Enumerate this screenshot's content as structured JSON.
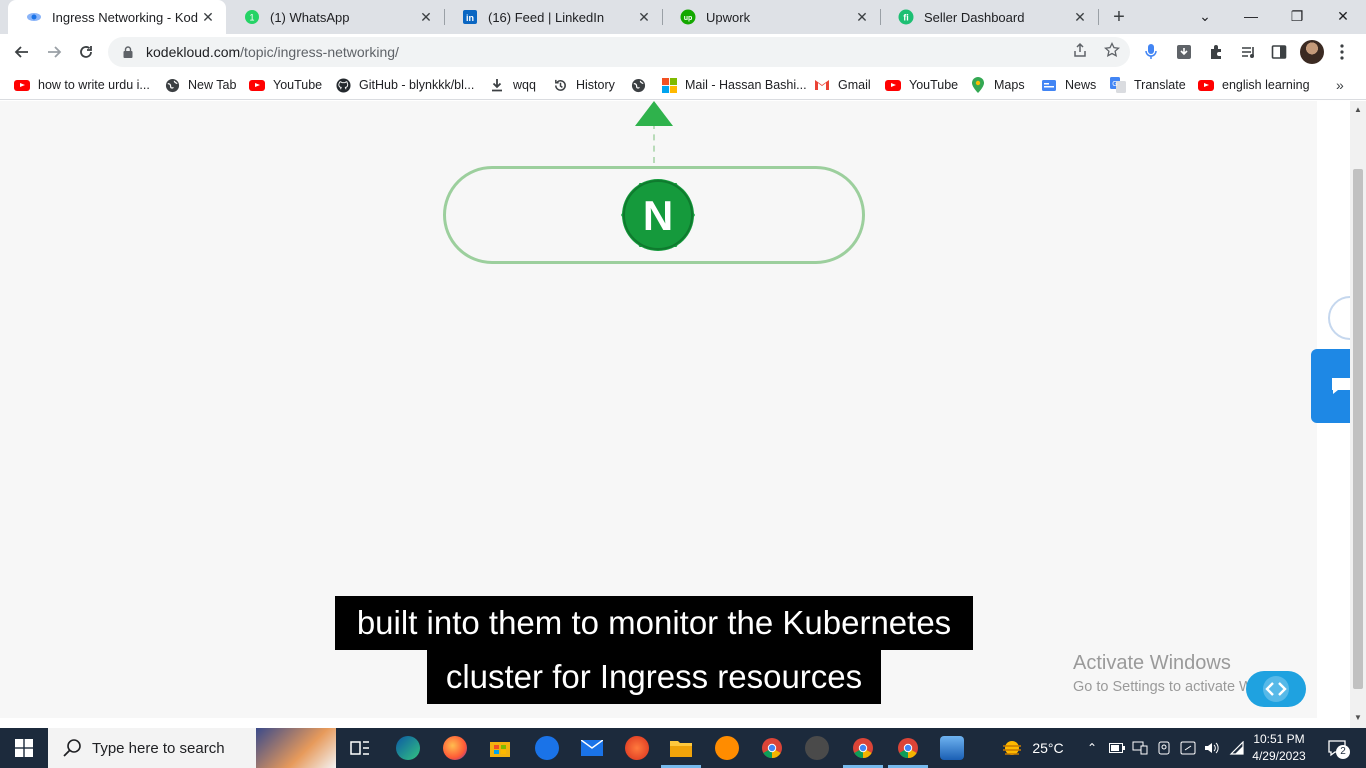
{
  "browser": {
    "tabs": [
      {
        "title": "Ingress Networking - KodeKl",
        "active": true,
        "favicon": "kodekloud-icon"
      },
      {
        "title": "(1) WhatsApp",
        "active": false,
        "favicon": "whatsapp-icon"
      },
      {
        "title": "(16) Feed | LinkedIn",
        "active": false,
        "favicon": "linkedin-icon"
      },
      {
        "title": "Upwork",
        "active": false,
        "favicon": "upwork-icon"
      },
      {
        "title": "Seller Dashboard",
        "active": false,
        "favicon": "fiverr-icon"
      }
    ],
    "new_tab_symbol": "+",
    "window_controls": {
      "dropdown": "⌄",
      "minimize": "—",
      "restore": "❐",
      "close": "✕"
    },
    "url_host": "kodekloud.com",
    "url_path": "/topic/ingress-networking/"
  },
  "bookmarks": [
    {
      "label": "how to write urdu i...",
      "icon": "youtube-icon"
    },
    {
      "label": "New Tab",
      "icon": "globe-icon"
    },
    {
      "label": "YouTube",
      "icon": "youtube-icon"
    },
    {
      "label": "GitHub - blynkkk/bl...",
      "icon": "github-icon"
    },
    {
      "label": "wqq",
      "icon": "download-icon"
    },
    {
      "label": "History",
      "icon": "history-icon"
    },
    {
      "label": "",
      "icon": "globe-icon"
    },
    {
      "label": "Mail - Hassan Bashi...",
      "icon": "microsoft-icon"
    },
    {
      "label": "Gmail",
      "icon": "gmail-icon"
    },
    {
      "label": "YouTube",
      "icon": "youtube-icon"
    },
    {
      "label": "Maps",
      "icon": "maps-icon"
    },
    {
      "label": "News",
      "icon": "news-icon"
    },
    {
      "label": "Translate",
      "icon": "translate-icon"
    },
    {
      "label": "english learning",
      "icon": "youtube-icon"
    }
  ],
  "video": {
    "logo_letter": "N",
    "caption_line_1": "built into them to monitor the Kubernetes",
    "caption_line_2": "cluster for Ingress resources"
  },
  "watermark": {
    "line1": "Activate Windows",
    "line2": "Go to Settings to activate Windows."
  },
  "taskbar": {
    "search_placeholder": "Type here to search",
    "weather": "25°C",
    "time": "10:51 PM",
    "date": "4/29/2023",
    "notification_count": "2"
  },
  "colors": {
    "nginx_green": "#159a3c",
    "pill_border": "#9ccf9d",
    "caption_bg": "#000000",
    "chat_button": "#1e88e5"
  }
}
